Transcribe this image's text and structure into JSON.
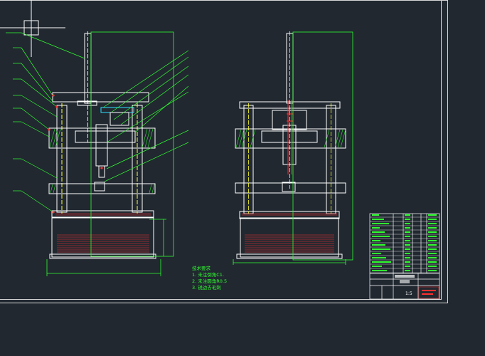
{
  "drawing": {
    "tech_notes": {
      "heading": "技术要求",
      "items": [
        "1. 未注倒角C1.",
        "2. 未注圆角R0.5",
        "3. 锐边去毛刺"
      ]
    },
    "title_block": {
      "scale_value": "1:5"
    },
    "colors": {
      "background": "#212830",
      "outline": "#ffffff",
      "border": "#d8d8d8",
      "leader": "#30ff30",
      "centerline": "#ffff30",
      "hatch": "#ff3030",
      "accent": "#ff3030",
      "cyan": "#30e0ff"
    }
  }
}
